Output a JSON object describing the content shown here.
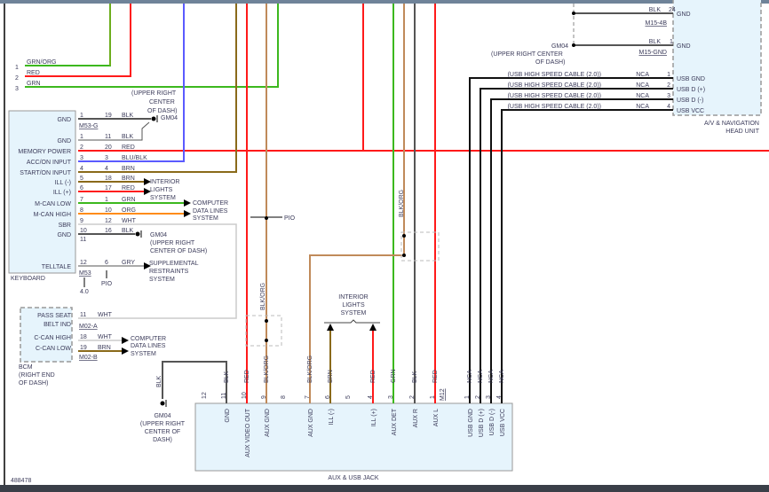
{
  "colors": {
    "red": "#ff1a1a",
    "green": "#3cb81e",
    "blue": "#5b5bff",
    "brown": "#8a6a1a",
    "blkorg": "#c08a5a",
    "orange": "#ff8c1a",
    "blk": "#555555",
    "wht": "#cccccc",
    "gry": "#aaaaaa",
    "nca": "#111111",
    "box": "#e6f4fc"
  },
  "top_wires": [
    {
      "pin": "1",
      "color": "GRN/ORG"
    },
    {
      "pin": "2",
      "color": "RED"
    },
    {
      "pin": "3",
      "color": "GRN"
    }
  ],
  "gm04_top": {
    "line1": "(UPPER RIGHT",
    "line2": "CENTER",
    "line3": "OF DASH)",
    "name": "GM04"
  },
  "keyboard": {
    "label": "KEYBOARD",
    "connector1": "M53-G",
    "connector2": "M53",
    "pins": [
      {
        "name": "GND",
        "pin": "1",
        "circuit": "19",
        "color": "BLK"
      },
      {
        "name": "GND",
        "pin": "1",
        "circuit": "11",
        "color": "BLK"
      },
      {
        "name": "MEMORY POWER",
        "pin": "2",
        "circuit": "20",
        "color": "RED"
      },
      {
        "name": "ACC/ON INPUT",
        "pin": "3",
        "circuit": "3",
        "color": "BLU/BLK"
      },
      {
        "name": "START/ON INPUT",
        "pin": "4",
        "circuit": "4",
        "color": "BRN"
      },
      {
        "name": "ILL (-)",
        "pin": "5",
        "circuit": "18",
        "color": "BRN"
      },
      {
        "name": "ILL (+)",
        "pin": "6",
        "circuit": "17",
        "color": "RED"
      },
      {
        "name": "M-CAN LOW",
        "pin": "7",
        "circuit": "1",
        "color": "GRN"
      },
      {
        "name": "M-CAN HIGH",
        "pin": "8",
        "circuit": "10",
        "color": "ORG"
      },
      {
        "name": "SBR",
        "pin": "9",
        "circuit": "12",
        "color": "WHT"
      },
      {
        "name": "GND",
        "pin": "10",
        "circuit": "16",
        "color": "BLK"
      },
      {
        "name": "",
        "pin": "11",
        "circuit": "",
        "color": ""
      },
      {
        "name": "TELLTALE",
        "pin": "12",
        "circuit": "6",
        "color": "GRY"
      }
    ],
    "refs": {
      "a": "4.0",
      "b": "PIO"
    }
  },
  "systems": {
    "interior1": "INTERIOR",
    "interior2": "LIGHTS",
    "interior3": "SYSTEM",
    "cdl1": "COMPUTER",
    "cdl2": "DATA LINES",
    "cdl3": "SYSTEM",
    "srs1": "SUPPLEMENTAL",
    "srs2": "RESTRAINTS",
    "srs3": "SYSTEM",
    "gm04_1": "GM04",
    "gm04_2": "(UPPER RIGHT",
    "gm04_3": "CENTER OF DASH)"
  },
  "bcm": {
    "label1": "BCM",
    "label2": "(RIGHT END",
    "label3": "OF DASH)",
    "pins": [
      {
        "name1": "PASS SEAT",
        "name2": "BELT IND",
        "pin": "11",
        "color": "WHT",
        "connector": "M02-A"
      },
      {
        "name1": "C-CAN HIGH",
        "pin": "18",
        "color": "WHT"
      },
      {
        "name1": "C-CAN LOW",
        "pin": "19",
        "color": "BRN",
        "connector": "M02-B"
      }
    ]
  },
  "pio_label": "PIO",
  "gnd_bottom": {
    "color": "BLK",
    "l1": "GM04",
    "l2": "(UPPER RIGHT",
    "l3": "CENTER OF",
    "l4": "DASH)"
  },
  "head_unit": {
    "label1": "A/V & NAVIGATION",
    "label2": "HEAD UNIT",
    "gnd_pins": [
      {
        "pin": "24",
        "color": "BLK",
        "name": "GND",
        "connector": "M15-4B"
      },
      {
        "pin": "1",
        "color": "BLK",
        "name": "GND",
        "connector": "M15-GND"
      }
    ],
    "gm04": "GM04",
    "gm04_l2": "(UPPER RIGHT CENTER",
    "gm04_l3": "OF DASH)",
    "usb": [
      {
        "cable": "(USB HIGH SPEED CABLE (2.0))",
        "color": "NCA",
        "pin": "1",
        "name": "USB GND"
      },
      {
        "cable": "(USB HIGH SPEED CABLE (2.0))",
        "color": "NCA",
        "pin": "2",
        "name": "USB D (+)"
      },
      {
        "cable": "(USB HIGH SPEED CABLE (2.0))",
        "color": "NCA",
        "pin": "3",
        "name": "USB D (-)"
      },
      {
        "cable": "(USB HIGH SPEED CABLE (2.0))",
        "color": "NCA",
        "pin": "4",
        "name": "USB VCC"
      }
    ]
  },
  "jack": {
    "label": "AUX & USB JACK",
    "connector": "M12",
    "pins": [
      {
        "pin": "12",
        "name": "",
        "color": ""
      },
      {
        "pin": "11",
        "name": "GND",
        "color": "BLK"
      },
      {
        "pin": "10",
        "name": "AUX VIDEO OUT",
        "color": "RED"
      },
      {
        "pin": "9",
        "name": "AUX GND",
        "color": "BLK/ORG"
      },
      {
        "pin": "8",
        "name": "",
        "color": ""
      },
      {
        "pin": "7",
        "name": "AUX GND",
        "color": "BLK/ORG"
      },
      {
        "pin": "6",
        "name": "ILL (-)",
        "color": "BRN"
      },
      {
        "pin": "5",
        "name": "",
        "color": ""
      },
      {
        "pin": "4",
        "name": "ILL (+)",
        "color": "RED"
      },
      {
        "pin": "3",
        "name": "AUX DET",
        "color": "GRN"
      },
      {
        "pin": "2",
        "name": "AUX R",
        "color": "BLK"
      },
      {
        "pin": "1",
        "name": "AUX L",
        "color": "RED"
      }
    ],
    "usb_pins": [
      {
        "pin": "1",
        "name": "USB GND",
        "color": "NCA"
      },
      {
        "pin": "2",
        "name": "USB D (+)",
        "color": "NCA"
      },
      {
        "pin": "3",
        "name": "USB D (-)",
        "color": "NCA"
      },
      {
        "pin": "4",
        "name": "USB VCC",
        "color": "NCA"
      }
    ]
  },
  "mid": {
    "blkorg": "BLK/ORG"
  },
  "figure_id": "488478"
}
